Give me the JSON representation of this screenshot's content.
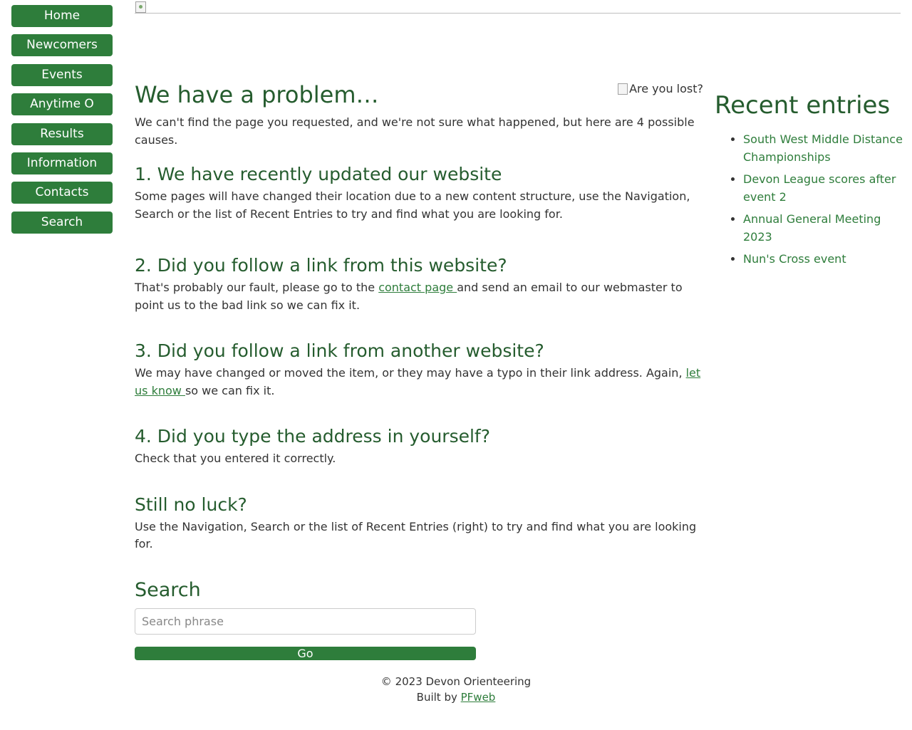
{
  "nav": {
    "items": [
      "Home",
      "Newcomers",
      "Events",
      "Anytime O",
      "Results",
      "Information",
      "Contacts",
      "Search"
    ]
  },
  "main": {
    "lost_alt": "Are you lost?",
    "title": "We have a problem…",
    "intro": "We can't find the page you requested, and we're not sure what happened, but here are 4 possible causes.",
    "s1": {
      "title": "1. We have recently updated our website",
      "text": "Some pages will have changed their location due to a new content structure, use the Navigation, Search or the list of Recent Entries to try and find what you are looking for."
    },
    "s2": {
      "title": "2. Did you follow a link from this website?",
      "pre": "That's probably our fault, please go to the ",
      "link": "contact page ",
      "post": "and send an email to our webmaster to point us to the bad link so we can fix it."
    },
    "s3": {
      "title": "3. Did you follow a link from another website?",
      "pre": "We may have changed or moved the item, or they may have a typo in their link address. Again, ",
      "link": "let us know ",
      "post": "so we can fix it."
    },
    "s4": {
      "title": "4. Did you type the address in yourself?",
      "text": "Check that you entered it correctly."
    },
    "s5": {
      "title": "Still no luck?",
      "text": "Use the Navigation, Search or the list of Recent Entries (right) to try and find what you are looking for."
    },
    "search": {
      "title": "Search",
      "placeholder": "Search phrase",
      "button": "Go"
    }
  },
  "aside": {
    "title": "Recent entries",
    "entries": [
      "South West Middle Distance Championships",
      "Devon League scores after event 2",
      "Annual General Meeting 2023",
      "Nun's Cross event"
    ]
  },
  "footer": {
    "copyright": "© 2023 Devon Orienteering",
    "built_by": "Built by ",
    "built_link": "PFweb"
  }
}
